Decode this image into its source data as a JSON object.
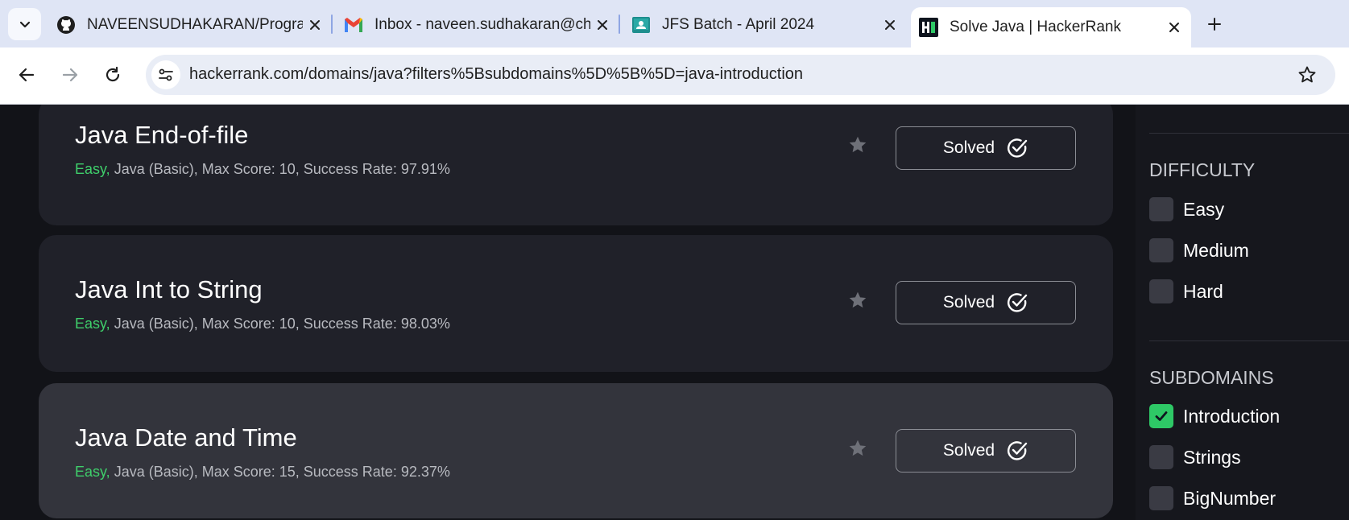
{
  "browser": {
    "tabs": [
      {
        "title": "NAVEENSUDHAKARAN/Program",
        "icon": "github-icon",
        "active": false
      },
      {
        "title": "Inbox - naveen.sudhakaran@ch",
        "icon": "gmail-icon",
        "active": false
      },
      {
        "title": "JFS Batch - April 2024",
        "icon": "classroom-icon",
        "active": false
      },
      {
        "title": "Solve Java | HackerRank",
        "icon": "hackerrank-icon",
        "active": true
      }
    ],
    "url": "hackerrank.com/domains/java?filters%5Bsubdomains%5D%5B%5D=java-introduction"
  },
  "challenges": [
    {
      "title": "Java End-of-file",
      "difficulty": "Easy,",
      "meta": " Java (Basic), Max Score: 10, Success Rate: 97.91%",
      "button": "Solved"
    },
    {
      "title": "Java Int to String",
      "difficulty": "Easy,",
      "meta": " Java (Basic), Max Score: 10, Success Rate: 98.03%",
      "button": "Solved"
    },
    {
      "title": "Java Date and Time",
      "difficulty": "Easy,",
      "meta": " Java (Basic), Max Score: 15, Success Rate: 92.37%",
      "button": "Solved"
    }
  ],
  "sidebar": {
    "difficulty": {
      "heading": "DIFFICULTY",
      "options": [
        {
          "label": "Easy",
          "checked": false
        },
        {
          "label": "Medium",
          "checked": false
        },
        {
          "label": "Hard",
          "checked": false
        }
      ]
    },
    "subdomains": {
      "heading": "SUBDOMAINS",
      "options": [
        {
          "label": "Introduction",
          "checked": true
        },
        {
          "label": "Strings",
          "checked": false
        },
        {
          "label": "BigNumber",
          "checked": false
        }
      ]
    }
  },
  "colors": {
    "easy": "#3fcf6b",
    "checkbox_on": "#2ec866",
    "card": "#202129",
    "card_hover": "#33343c"
  }
}
